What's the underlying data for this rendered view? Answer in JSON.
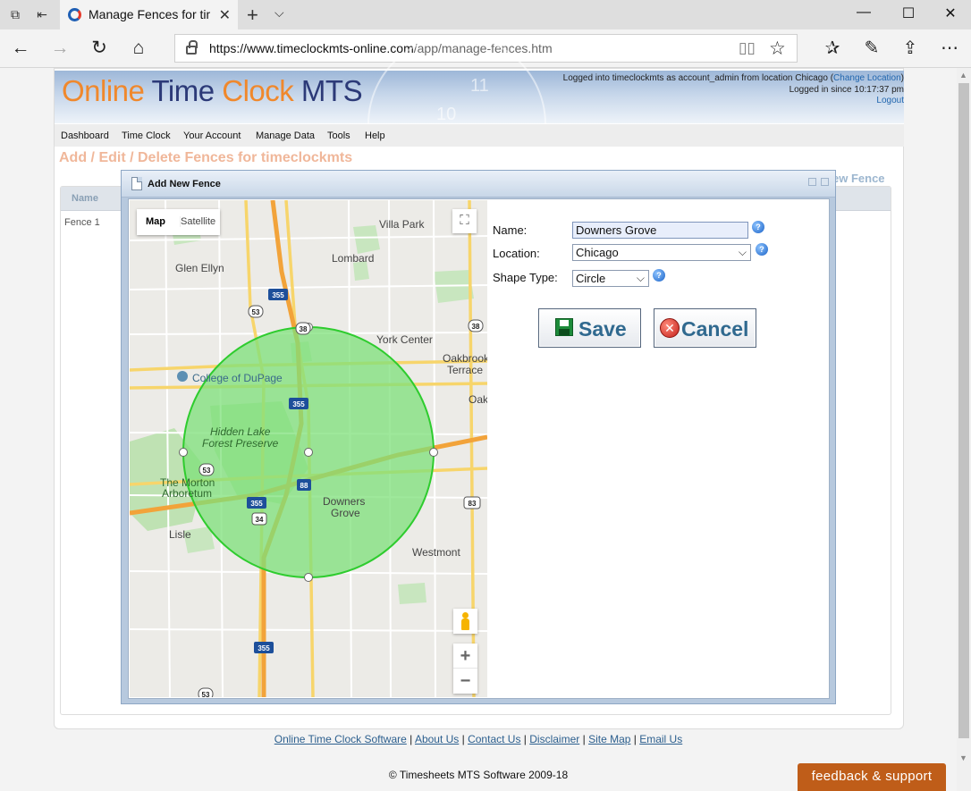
{
  "browser": {
    "tab_title": "Manage Fences for time",
    "url_host": "https://www.timeclockmts-online.com",
    "url_path": "/app/manage-fences.htm"
  },
  "site": {
    "logo_online": "Online",
    "logo_time": " Time",
    "logo_clock": " Clock",
    "logo_mts": " MTS",
    "login_prefix": "Logged into timeclockmts as account_admin from location Chicago (",
    "change_location": "Change Location",
    "login_suffix": ")",
    "logged_since": "Logged in since 10:17:37 pm",
    "logout": "Logout",
    "menu": [
      "Dashboard",
      "Time Clock",
      "Your Account",
      "Manage Data",
      "Tools",
      "Help"
    ]
  },
  "page": {
    "heading": "Add / Edit / Delete Fences for timeclockmts",
    "new_fence_link": "ew Fence",
    "grid_header_name": "Name",
    "grid_rows": [
      "Fence 1"
    ]
  },
  "dialog": {
    "title": "Add New Fence",
    "map_tab": "Map",
    "satellite_tab": "Satellite",
    "name_label": "Name:",
    "name_value": "Downers Grove",
    "location_label": "Location:",
    "location_value": "Chicago",
    "shape_label": "Shape Type:",
    "shape_value": "Circle",
    "save_label": "Save",
    "cancel_label": "Cancel",
    "help_glyph": "?"
  },
  "map_labels": {
    "villa_park": "Villa Park",
    "lombard": "Lombard",
    "glen_ellyn": "Glen Ellyn",
    "york_center": "York Center",
    "oakbrook1": "Oakbrook",
    "oakbrook2": "Terrace",
    "oak": "Oak",
    "college": "College of DuPage",
    "hidden1": "Hidden Lake",
    "hidden2": "Forest Preserve",
    "morton1": "The Morton",
    "morton2": "Arboretum",
    "downers1": "Downers",
    "downers2": "Grove",
    "lisle": "Lisle",
    "westmont": "Westmont",
    "r355a": "355",
    "r53a": "53",
    "r38a": "38",
    "r38b": "38",
    "r355b": "355",
    "r53b": "53",
    "r88": "88",
    "r355c": "355",
    "r34": "34",
    "r83": "83",
    "r355d": "355",
    "r53c": "53"
  },
  "footer": {
    "links": [
      "Online Time Clock Software",
      "About Us",
      "Contact Us",
      "Disclaimer",
      "Site Map",
      "Email Us"
    ],
    "separator": " | ",
    "copyright": "© Timesheets MTS Software 2009-18",
    "feedback": "feedback & support"
  },
  "colors": {
    "accent_orange": "#f0882c",
    "brand_navy": "#2c3a78",
    "fence_fill": "#7ee07a",
    "fence_stroke": "#2ecc2e",
    "feedback_bg": "#bf5d19"
  },
  "icons": {
    "tab_favicon": "edge-favicon",
    "back": "arrow-left",
    "forward": "arrow-right",
    "refresh": "refresh",
    "home": "home",
    "lock": "lock",
    "star": "star"
  }
}
